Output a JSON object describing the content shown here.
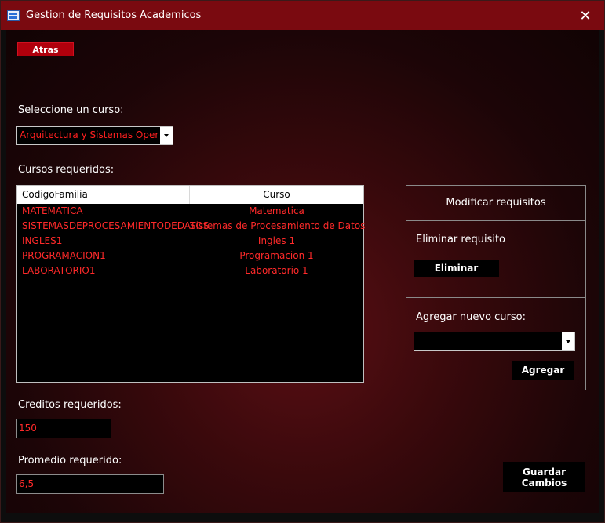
{
  "window": {
    "title": "Gestion de Requisitos Academicos",
    "close_glyph": "✕"
  },
  "back_button": "Atras",
  "course_select": {
    "label": "Seleccione un curso:",
    "value": "Arquitectura y Sistemas Operat"
  },
  "required_courses": {
    "label": "Cursos requeridos:",
    "columns": [
      "CodigoFamilia",
      "Curso"
    ],
    "rows": [
      [
        "MATEMATICA",
        "Matematica"
      ],
      [
        "SISTEMASDEPROCESAMIENTODEDATOS",
        "Sistemas de Procesamiento de Datos"
      ],
      [
        "INGLES1",
        "Ingles 1"
      ],
      [
        "PROGRAMACION1",
        "Programacion 1"
      ],
      [
        "LABORATORIO1",
        "Laboratorio 1"
      ]
    ]
  },
  "modify_panel": {
    "title": "Modificar requisitos",
    "delete_label": "Eliminar requisito",
    "delete_button": "Eliminar",
    "add_label": "Agregar nuevo curso:",
    "add_value": "",
    "add_button": "Agregar"
  },
  "credits": {
    "label": "Creditos requeridos:",
    "value": "150"
  },
  "average": {
    "label": "Promedio requerido:",
    "value": "6,5"
  },
  "save_button": {
    "line1": "Guardar",
    "line2": "Cambios"
  },
  "colors": {
    "titlebar": "#7a0a10",
    "accent_red": "#ff2a2a",
    "button_red": "#b0000c"
  }
}
